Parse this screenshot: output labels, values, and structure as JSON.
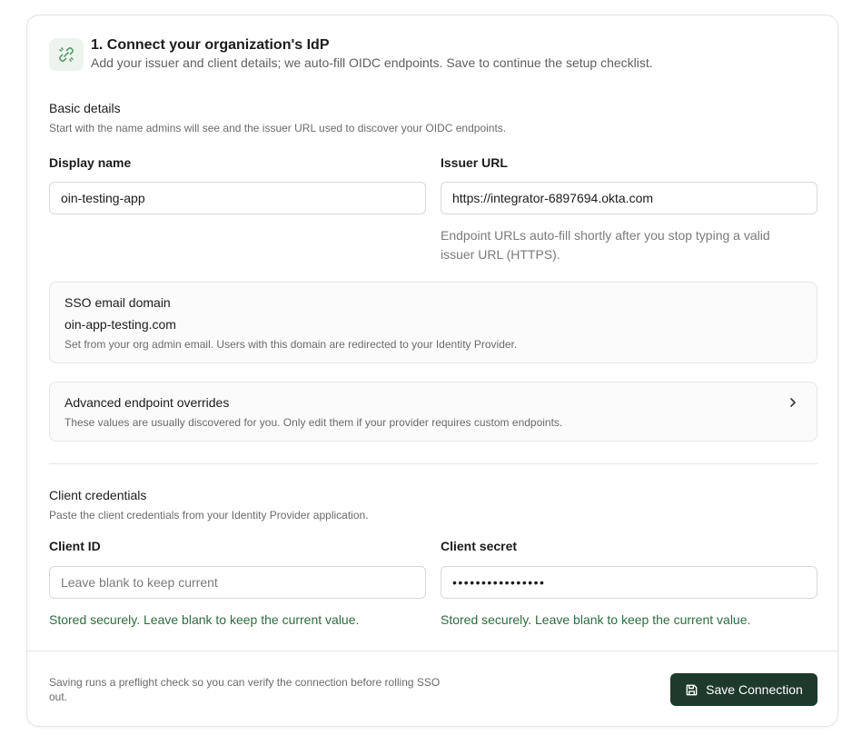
{
  "header": {
    "icon": "plug-link-icon",
    "title": "1. Connect your organization's IdP",
    "subtitle": "Add your issuer and client details; we auto-fill OIDC endpoints. Save to continue the setup checklist."
  },
  "basic_details": {
    "title": "Basic details",
    "description": "Start with the name admins will see and the issuer URL used to discover your OIDC endpoints.",
    "display_name": {
      "label": "Display name",
      "value": "oin-testing-app"
    },
    "issuer_url": {
      "label": "Issuer URL",
      "value": "https://integrator-6897694.okta.com",
      "hint": "Endpoint URLs auto-fill shortly after you stop typing a valid issuer URL (HTTPS)."
    }
  },
  "sso_domain": {
    "title": "SSO email domain",
    "value": "oin-app-testing.com",
    "description": "Set from your org admin email. Users with this domain are redirected to your Identity Provider."
  },
  "advanced": {
    "title": "Advanced endpoint overrides",
    "description": "These values are usually discovered for you. Only edit them if your provider requires custom endpoints.",
    "icon": "chevron-right-icon"
  },
  "credentials": {
    "title": "Client credentials",
    "description": "Paste the client credentials from your Identity Provider application.",
    "client_id": {
      "label": "Client ID",
      "value": "",
      "placeholder": "Leave blank to keep current",
      "status": "Stored securely. Leave blank to keep the current value."
    },
    "client_secret": {
      "label": "Client secret",
      "value": "••••••••••••••••",
      "status": "Stored securely. Leave blank to keep the current value."
    }
  },
  "footer": {
    "note": "Saving runs a preflight check so you can verify the connection before rolling SSO out.",
    "save_label": "Save Connection",
    "save_icon": "floppy-disk-icon"
  },
  "colors": {
    "accent": "#1e3a2c",
    "success_text": "#2e6b3f",
    "icon_bg": "#edf4ee"
  }
}
